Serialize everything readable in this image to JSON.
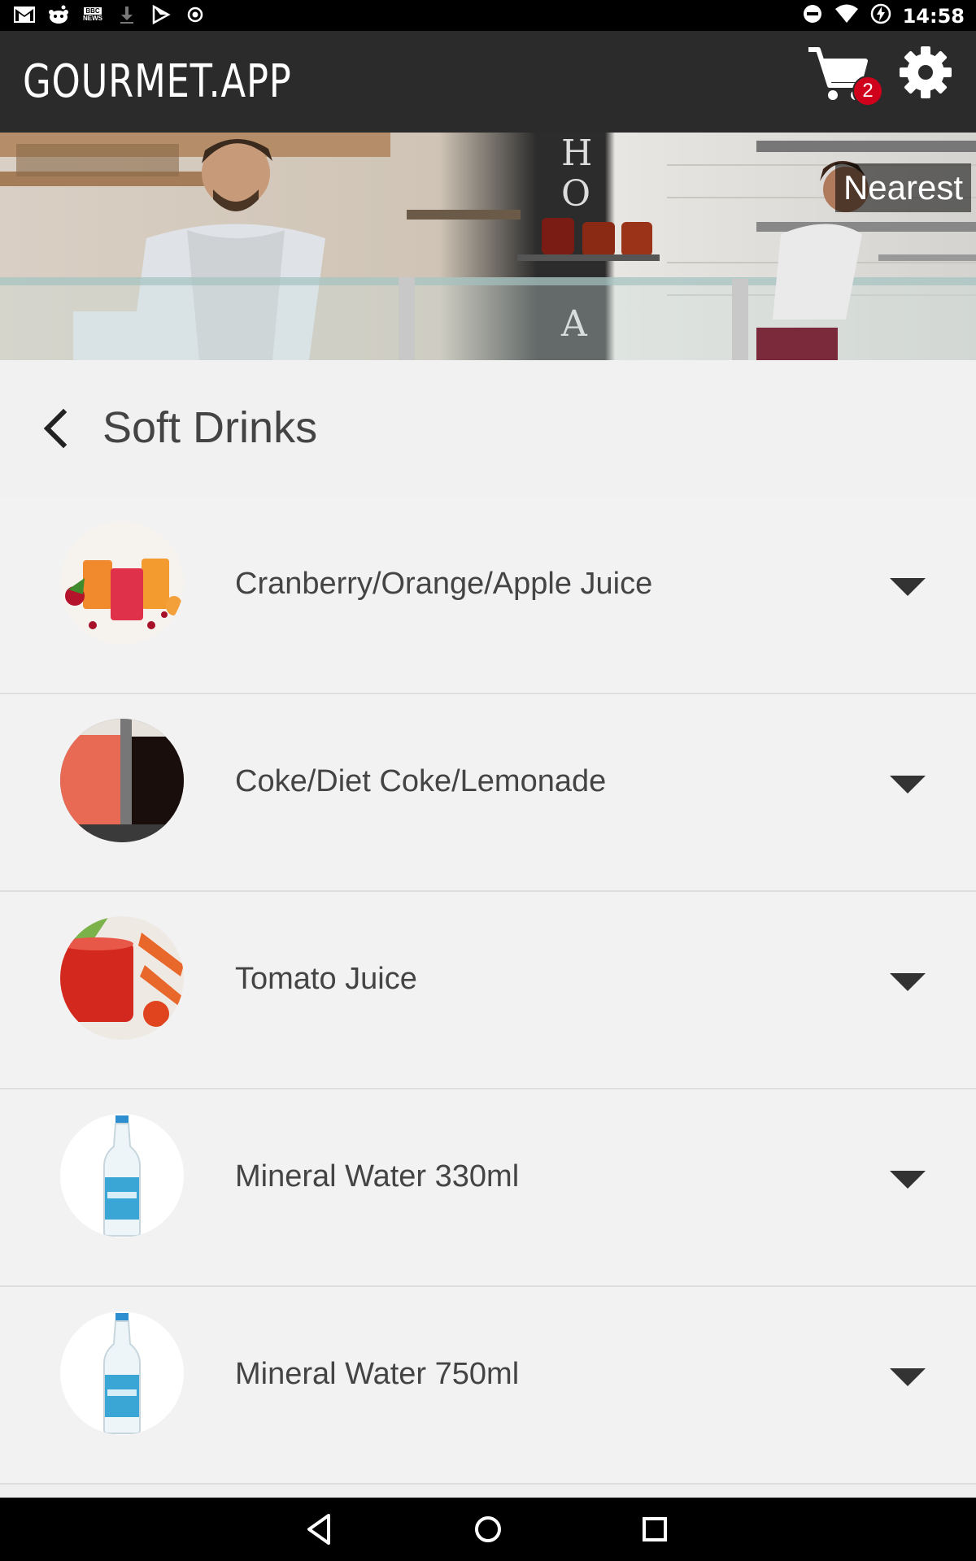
{
  "status_bar": {
    "time": "14:58",
    "left_icons": [
      "gmail-icon",
      "reddit-icon",
      "bbc-news-icon",
      "download-icon",
      "flipboard-icon",
      "record-icon"
    ],
    "right_icons": [
      "do-not-disturb-icon",
      "wifi-icon",
      "battery-charging-icon"
    ],
    "bbc_label_1": "BBC",
    "bbc_label_2": "NEWS"
  },
  "app_bar": {
    "title": "GOURMET.APP",
    "cart_count": "2"
  },
  "hero": {
    "location_tag": "Nearest"
  },
  "section": {
    "title": "Soft Drinks"
  },
  "items": [
    {
      "name": "Cranberry/Orange/Apple Juice",
      "image": "juice-glasses"
    },
    {
      "name": "Coke/Diet Coke/Lemonade",
      "image": "cola-glasses"
    },
    {
      "name": "Tomato Juice",
      "image": "tomato-juice"
    },
    {
      "name": "Mineral Water 330ml",
      "image": "water-bottle"
    },
    {
      "name": "Mineral Water 750ml",
      "image": "water-bottle"
    }
  ],
  "colors": {
    "app_bar": "#2b2b2b",
    "badge": "#d0021b",
    "background": "#efefef"
  }
}
